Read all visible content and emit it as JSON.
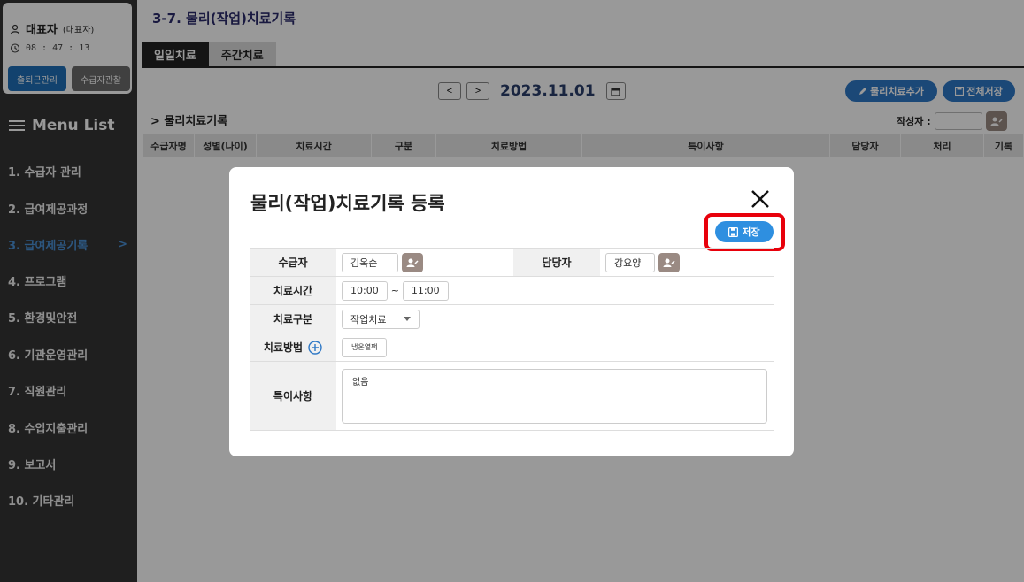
{
  "sidebar": {
    "user_name": "대표자",
    "user_role": "(대표자)",
    "timer": "08 : 47 : 13",
    "attendance_btn": "출퇴근관리",
    "recipient_btn": "수급자관찰",
    "menu_title": "Menu List",
    "items": [
      {
        "label": "1. 수급자 관리"
      },
      {
        "label": "2. 급여제공과정"
      },
      {
        "label": "3. 급여제공기록",
        "arrow": ">"
      },
      {
        "label": "4. 프로그램"
      },
      {
        "label": "5. 환경및안전"
      },
      {
        "label": "6. 기관운영관리"
      },
      {
        "label": "7. 직원관리"
      },
      {
        "label": "8. 수입지출관리"
      },
      {
        "label": "9. 보고서"
      },
      {
        "label": "10. 기타관리"
      }
    ]
  },
  "header": {
    "title": "3-7. 물리(작업)치료기록",
    "tabs": [
      {
        "label": "일일치료"
      },
      {
        "label": "주간치료"
      }
    ],
    "prev": "<",
    "next": ">",
    "date": "2023.11.01",
    "add_btn": "물리치료추가",
    "save_all_btn": "전체저장",
    "section_title": "> 물리치료기록",
    "author_label": "작성자 :"
  },
  "table": {
    "columns": [
      "수급자명",
      "성별(나이)",
      "치료시간",
      "구분",
      "치료방법",
      "특이사항",
      "담당자",
      "처리",
      "기록"
    ]
  },
  "modal": {
    "title": "물리(작업)치료기록 등록",
    "save_label": "저장",
    "recipient_label": "수급자",
    "recipient_value": "김옥순",
    "staff_label": "담당자",
    "staff_value": "강요양",
    "time_label": "치료시간",
    "time_start": "10:00",
    "time_sep": "~",
    "time_end": "11:00",
    "type_label": "치료구분",
    "type_value": "작업치료",
    "method_label": "치료방법",
    "method_value": "냉온열팩",
    "notes_label": "특이사항",
    "notes_value": "없음"
  },
  "colors": {
    "accent": "#2e78c6",
    "highlight": "#e8000b",
    "sidebar_bg": "#343434"
  }
}
